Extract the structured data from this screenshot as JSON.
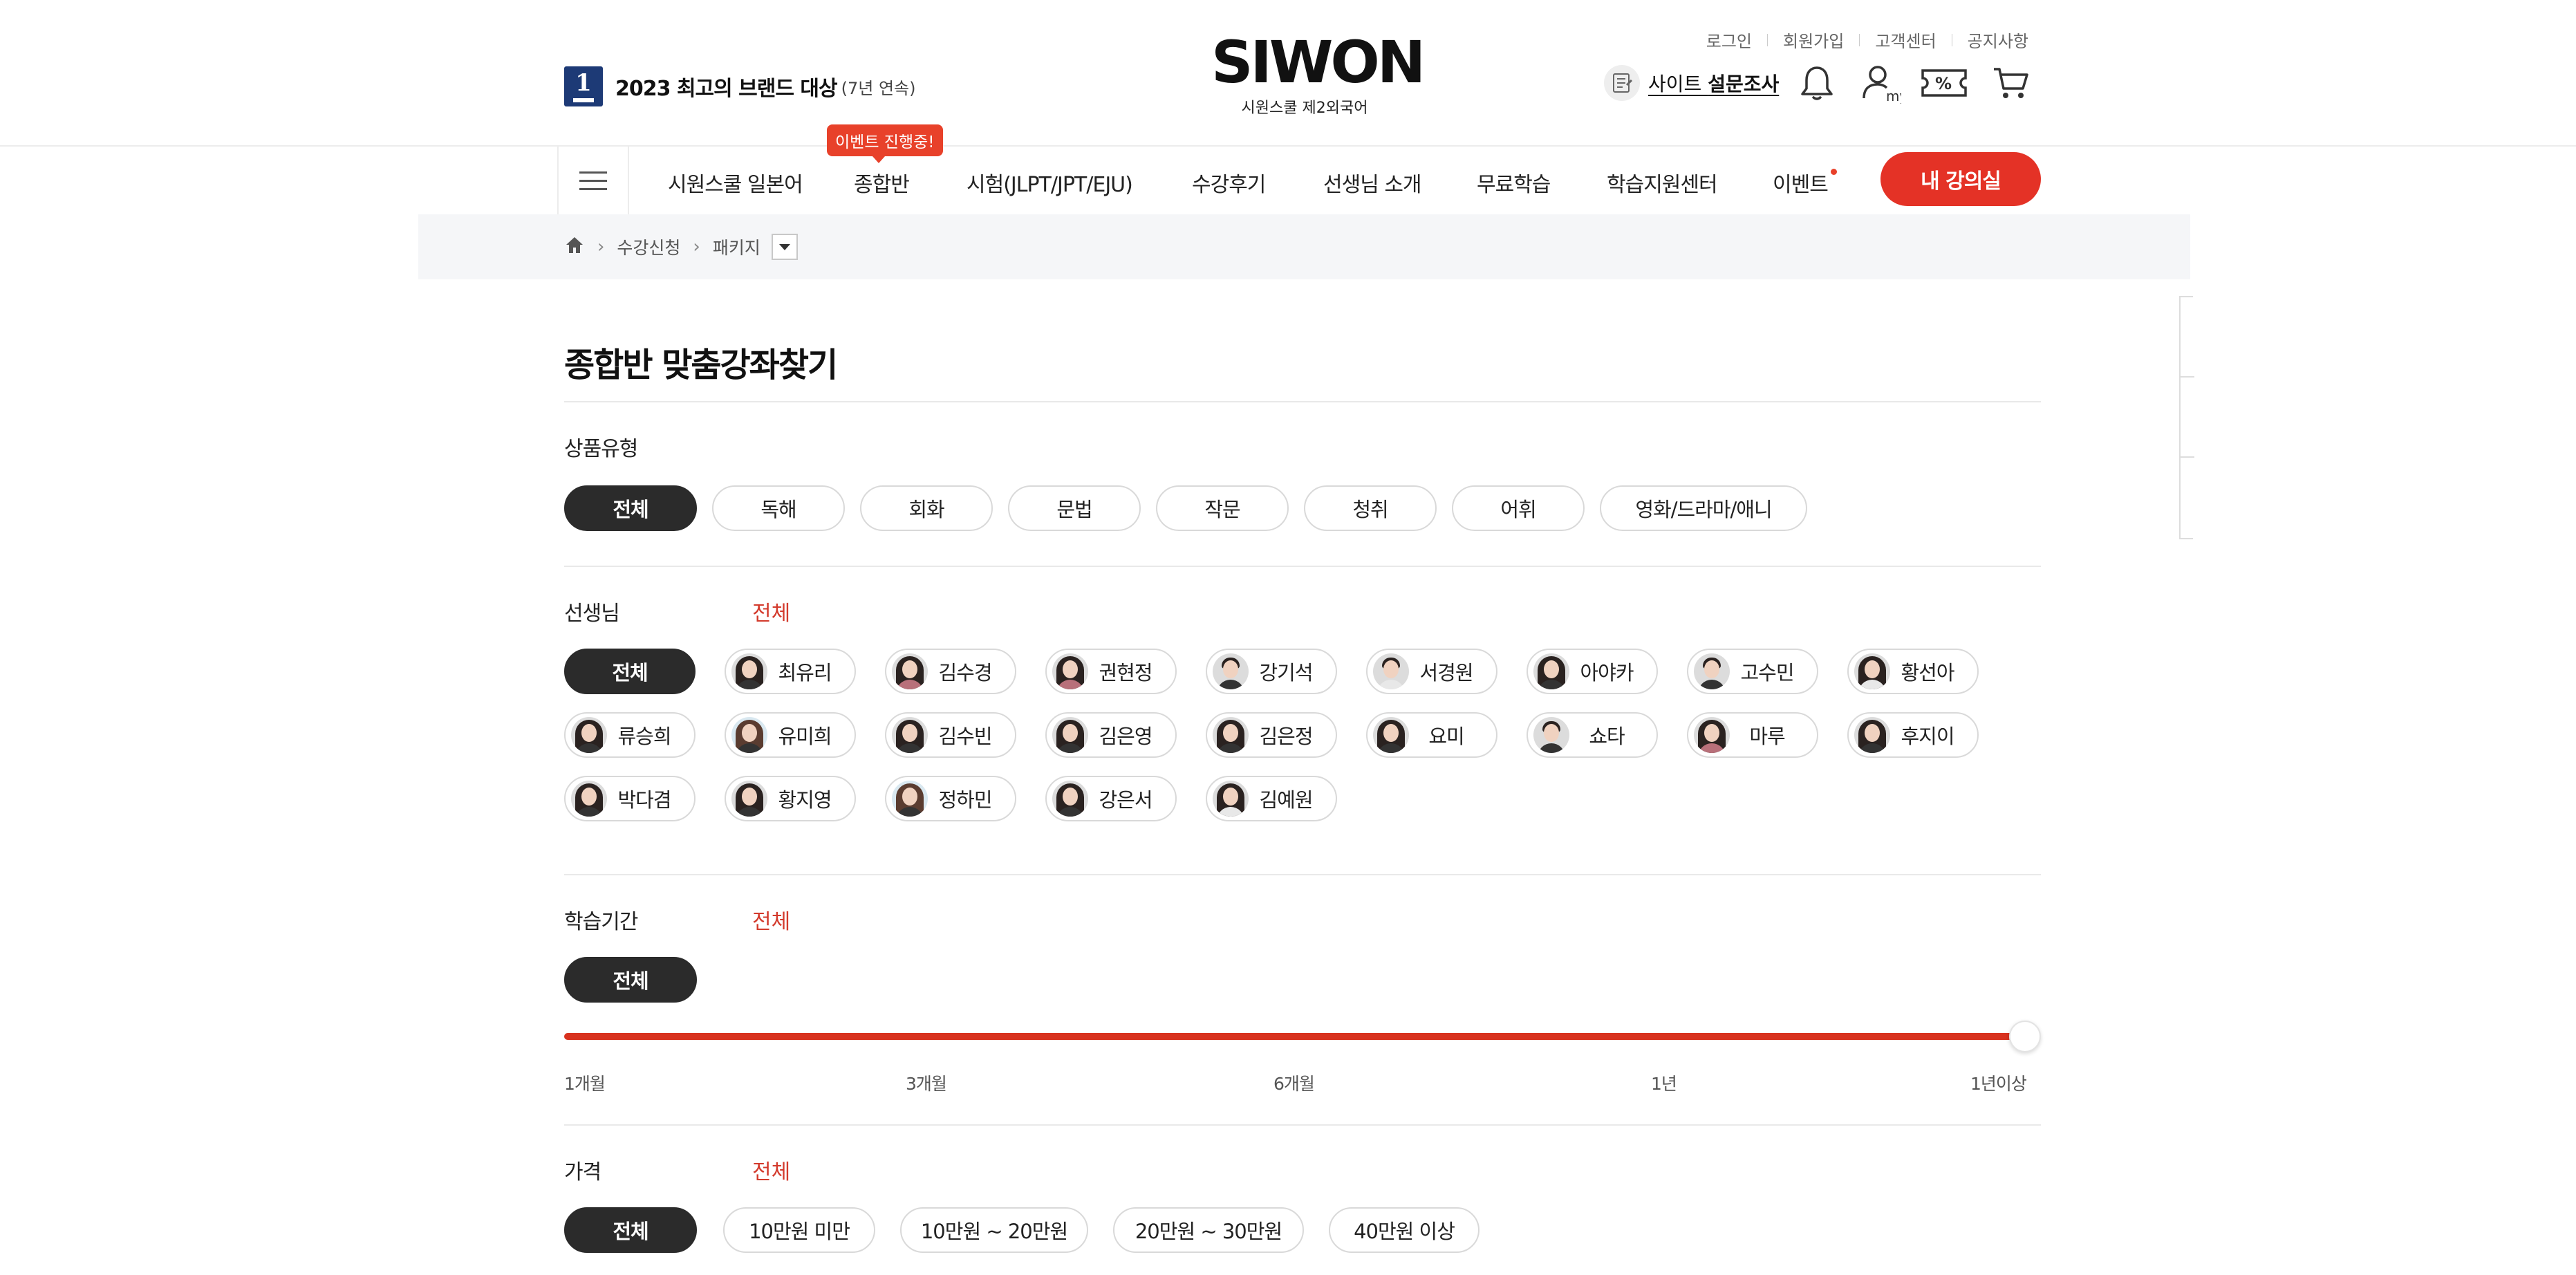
{
  "header": {
    "award_number": "1",
    "award_text": "2023 최고의 브랜드 대상",
    "award_sub": "(7년 연속)",
    "logo_text": "SIWON",
    "logo_sub": "시원스쿨 제2외국어",
    "util_links": [
      "로그인",
      "회원가입",
      "고객센터",
      "공지사항"
    ],
    "survey_prefix": "사이트 ",
    "survey_bold": "설문조사",
    "icons": [
      "bell-icon",
      "my-page-icon",
      "coupon-icon",
      "cart-icon"
    ],
    "my_icon_label": "my",
    "coupon_icon_label": "%"
  },
  "gnb": {
    "items": [
      "시원스쿨 일본어",
      "종합반",
      "시험(JLPT/JPT/EJU)",
      "수강후기",
      "선생님 소개",
      "무료학습",
      "학습지원센터",
      "이벤트"
    ],
    "event_tag": "이벤트 진행중!",
    "my_lecture": "내 강의실",
    "accent": "#e43226"
  },
  "breadcrumb": {
    "items": [
      "수강신청",
      "패키지"
    ]
  },
  "page": {
    "title": "종합반 맞춤강좌찾기"
  },
  "product_type": {
    "label": "상품유형",
    "options": [
      "전체",
      "독해",
      "회화",
      "문법",
      "작문",
      "청취",
      "어휘",
      "영화/드라마/애니"
    ],
    "selected": "전체"
  },
  "teachers": {
    "label": "선생님",
    "selected_text": "전체",
    "all_label": "전체",
    "list": [
      "최유리",
      "김수경",
      "권현정",
      "강기석",
      "서경원",
      "아야카",
      "고수민",
      "황선아",
      "류승희",
      "유미희",
      "김수빈",
      "김은영",
      "김은정",
      "요미",
      "쇼타",
      "마루",
      "후지이",
      "박다겸",
      "황지영",
      "정하민",
      "강은서",
      "김예원"
    ]
  },
  "period": {
    "label": "학습기간",
    "selected_text": "전체",
    "all_label": "전체",
    "ticks": [
      "1개월",
      "3개월",
      "6개월",
      "1년",
      "1년이상"
    ],
    "slider_value_fraction": 1.0
  },
  "price": {
    "label": "가격",
    "selected_text": "전체",
    "options": [
      "전체",
      "10만원 미만",
      "10만원 ~ 20만원",
      "20만원 ~ 30만원",
      "40만원 이상"
    ],
    "selected": "전체"
  }
}
